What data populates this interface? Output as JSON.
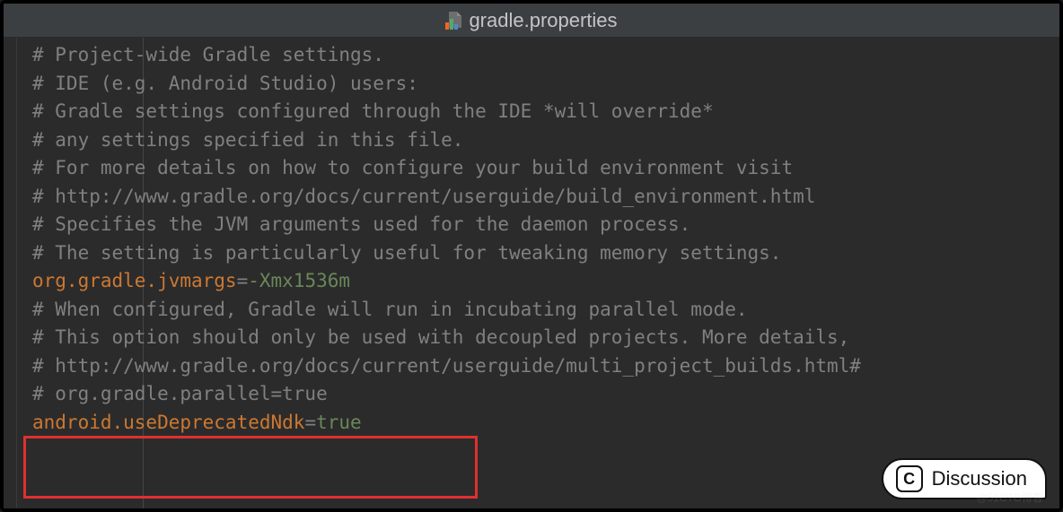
{
  "tab": {
    "filename": "gradle.properties",
    "icon": "gradle-file-icon"
  },
  "code": {
    "lines": [
      {
        "type": "comment",
        "text": "# Project-wide Gradle settings."
      },
      {
        "type": "comment",
        "text": "# IDE (e.g. Android Studio) users:"
      },
      {
        "type": "comment",
        "text": "# Gradle settings configured through the IDE *will override*"
      },
      {
        "type": "comment",
        "text": "# any settings specified in this file."
      },
      {
        "type": "comment",
        "text": "# For more details on how to configure your build environment visit"
      },
      {
        "type": "comment",
        "text": "# http://www.gradle.org/docs/current/userguide/build_environment.html"
      },
      {
        "type": "comment",
        "text": "# Specifies the JVM arguments used for the daemon process."
      },
      {
        "type": "comment",
        "text": "# The setting is particularly useful for tweaking memory settings."
      },
      {
        "type": "property",
        "key": "org.gradle.jvmargs",
        "eq": "=",
        "flag": "-Xmx1536m",
        "value": ""
      },
      {
        "type": "comment",
        "text": "# When configured, Gradle will run in incubating parallel mode."
      },
      {
        "type": "comment",
        "text": "# This option should only be used with decoupled projects. More details,"
      },
      {
        "type": "comment",
        "text": "# http://www.gradle.org/docs/current/userguide/multi_project_builds.html#"
      },
      {
        "type": "comment",
        "text": "# org.gradle.parallel=true"
      },
      {
        "type": "property",
        "key": "android.useDeprecatedNdk",
        "eq": "=",
        "flag": "true",
        "value": ""
      }
    ]
  },
  "annotation": {
    "highlight_description": "red rectangle around last two lines"
  },
  "badge": {
    "letter": "C",
    "label": "Discussion"
  },
  "watermark": "@51CTO博客"
}
